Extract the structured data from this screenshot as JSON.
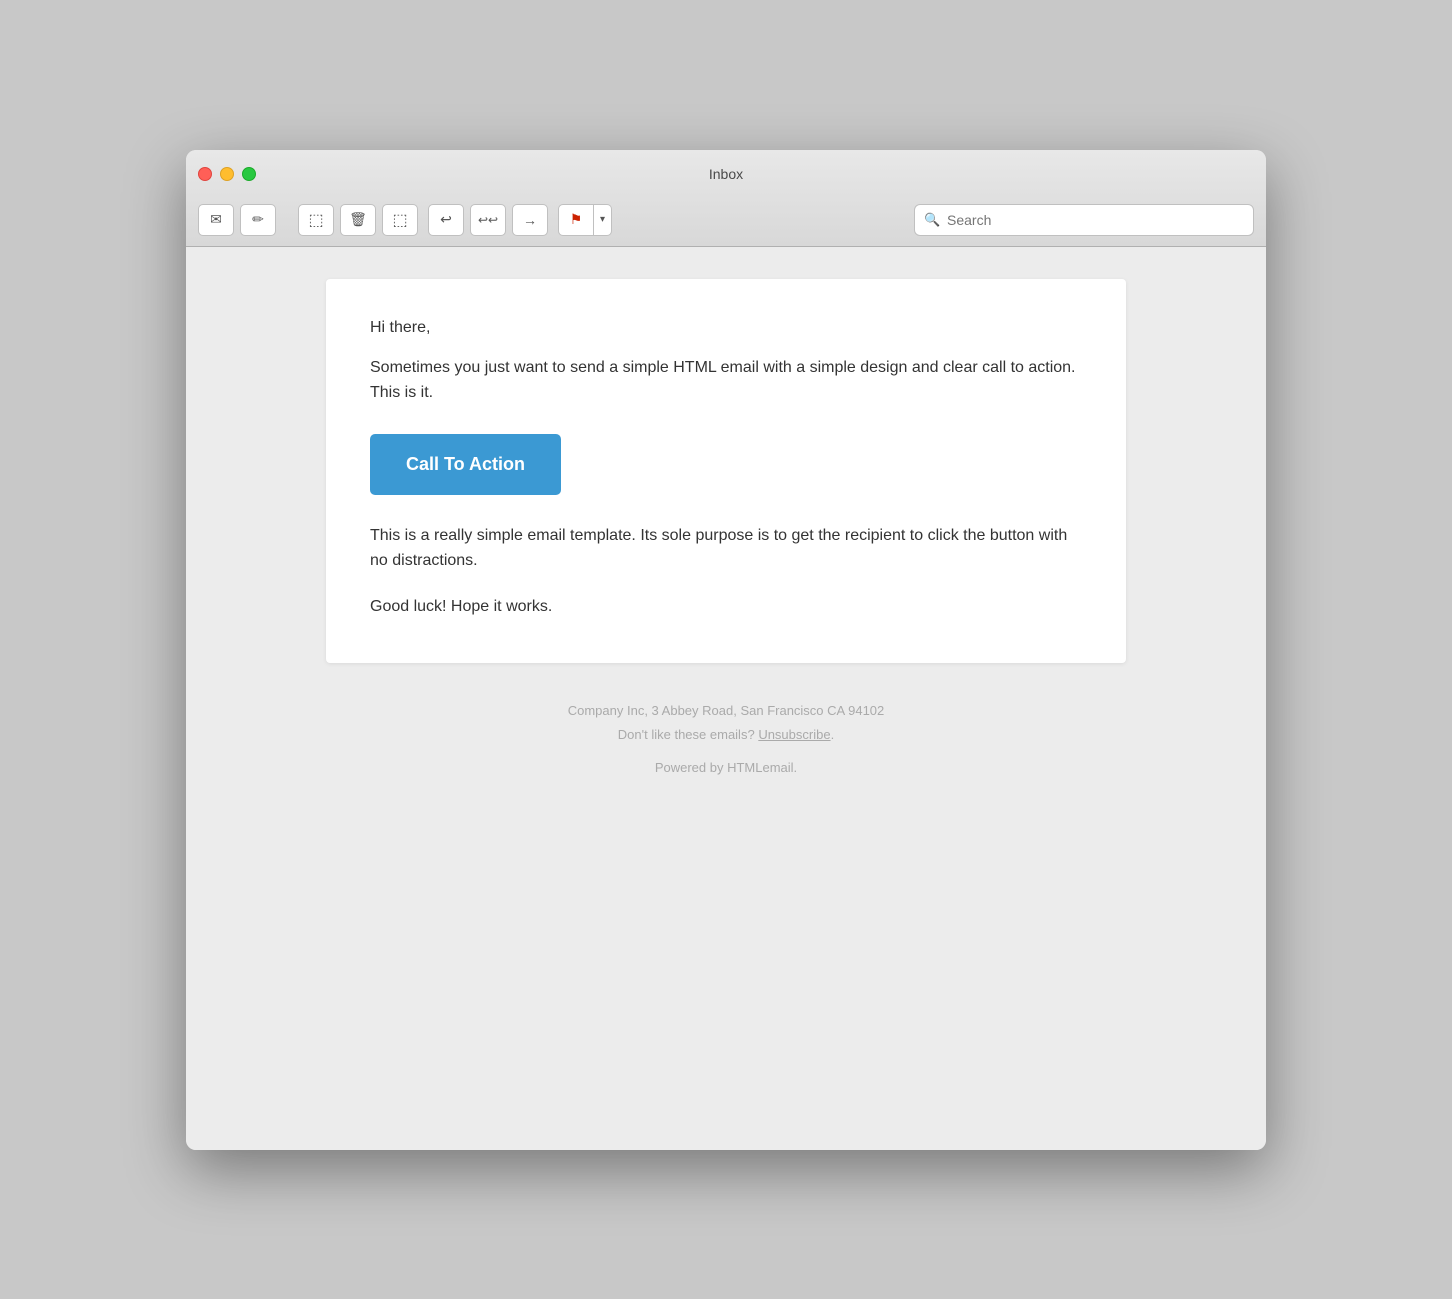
{
  "window": {
    "title": "Inbox"
  },
  "toolbar": {
    "compose_label": "✉",
    "edit_label": "✏",
    "archive_label": "⬜",
    "trash_label": "🗑",
    "junk_label": "⬜",
    "reply_label": "↩",
    "reply_all_label": "↩↩",
    "forward_label": "→",
    "flag_label": "⚑",
    "dropdown_label": "▾",
    "search_placeholder": "Search"
  },
  "email": {
    "greeting": "Hi there,",
    "intro": "Sometimes you just want to send a simple HTML email with a simple design and clear call to action. This is it.",
    "cta_button": "Call To Action",
    "body": "This is a really simple email template. Its sole purpose is to get the recipient to click the button with no distractions.",
    "closing": "Good luck! Hope it works.",
    "footer_address": "Company Inc, 3 Abbey Road, San Francisco CA 94102",
    "footer_unsubscribe_prefix": "Don't like these emails?",
    "footer_unsubscribe_link": "Unsubscribe",
    "footer_unsubscribe_suffix": ".",
    "footer_powered": "Powered by HTMLemail."
  }
}
